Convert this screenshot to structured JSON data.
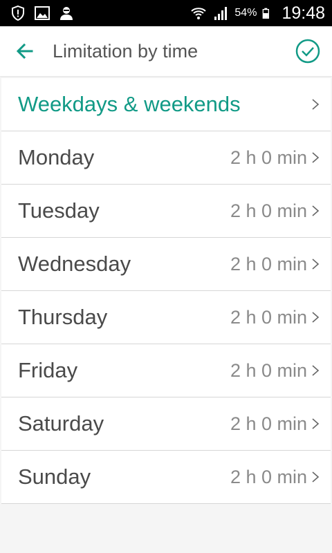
{
  "colors": {
    "accent": "#119a86",
    "status_bar": "#000000",
    "background": "#f5f5f5",
    "text_primary": "#4a4a4a",
    "text_secondary": "#8a8a8a"
  },
  "status_bar": {
    "left_icons": [
      "alert-shield-icon",
      "image-icon",
      "avatar-icon"
    ],
    "right_icons": [
      "wifi-icon",
      "signal-icon",
      "battery-icon"
    ],
    "battery": "54%",
    "time": "19:48"
  },
  "app_bar": {
    "back_icon": "arrow-left-icon",
    "title": "Limitation by time",
    "confirm_icon": "check-circle-icon"
  },
  "list": {
    "header": {
      "label": "Weekdays & weekends",
      "icon": "chevron-right-icon"
    },
    "days": [
      {
        "label": "Monday",
        "value": "2 h 0 min"
      },
      {
        "label": "Tuesday",
        "value": "2 h 0 min"
      },
      {
        "label": "Wednesday",
        "value": "2 h 0 min"
      },
      {
        "label": "Thursday",
        "value": "2 h 0 min"
      },
      {
        "label": "Friday",
        "value": "2 h 0 min"
      },
      {
        "label": "Saturday",
        "value": "2 h 0 min"
      },
      {
        "label": "Sunday",
        "value": "2 h 0 min"
      }
    ]
  }
}
